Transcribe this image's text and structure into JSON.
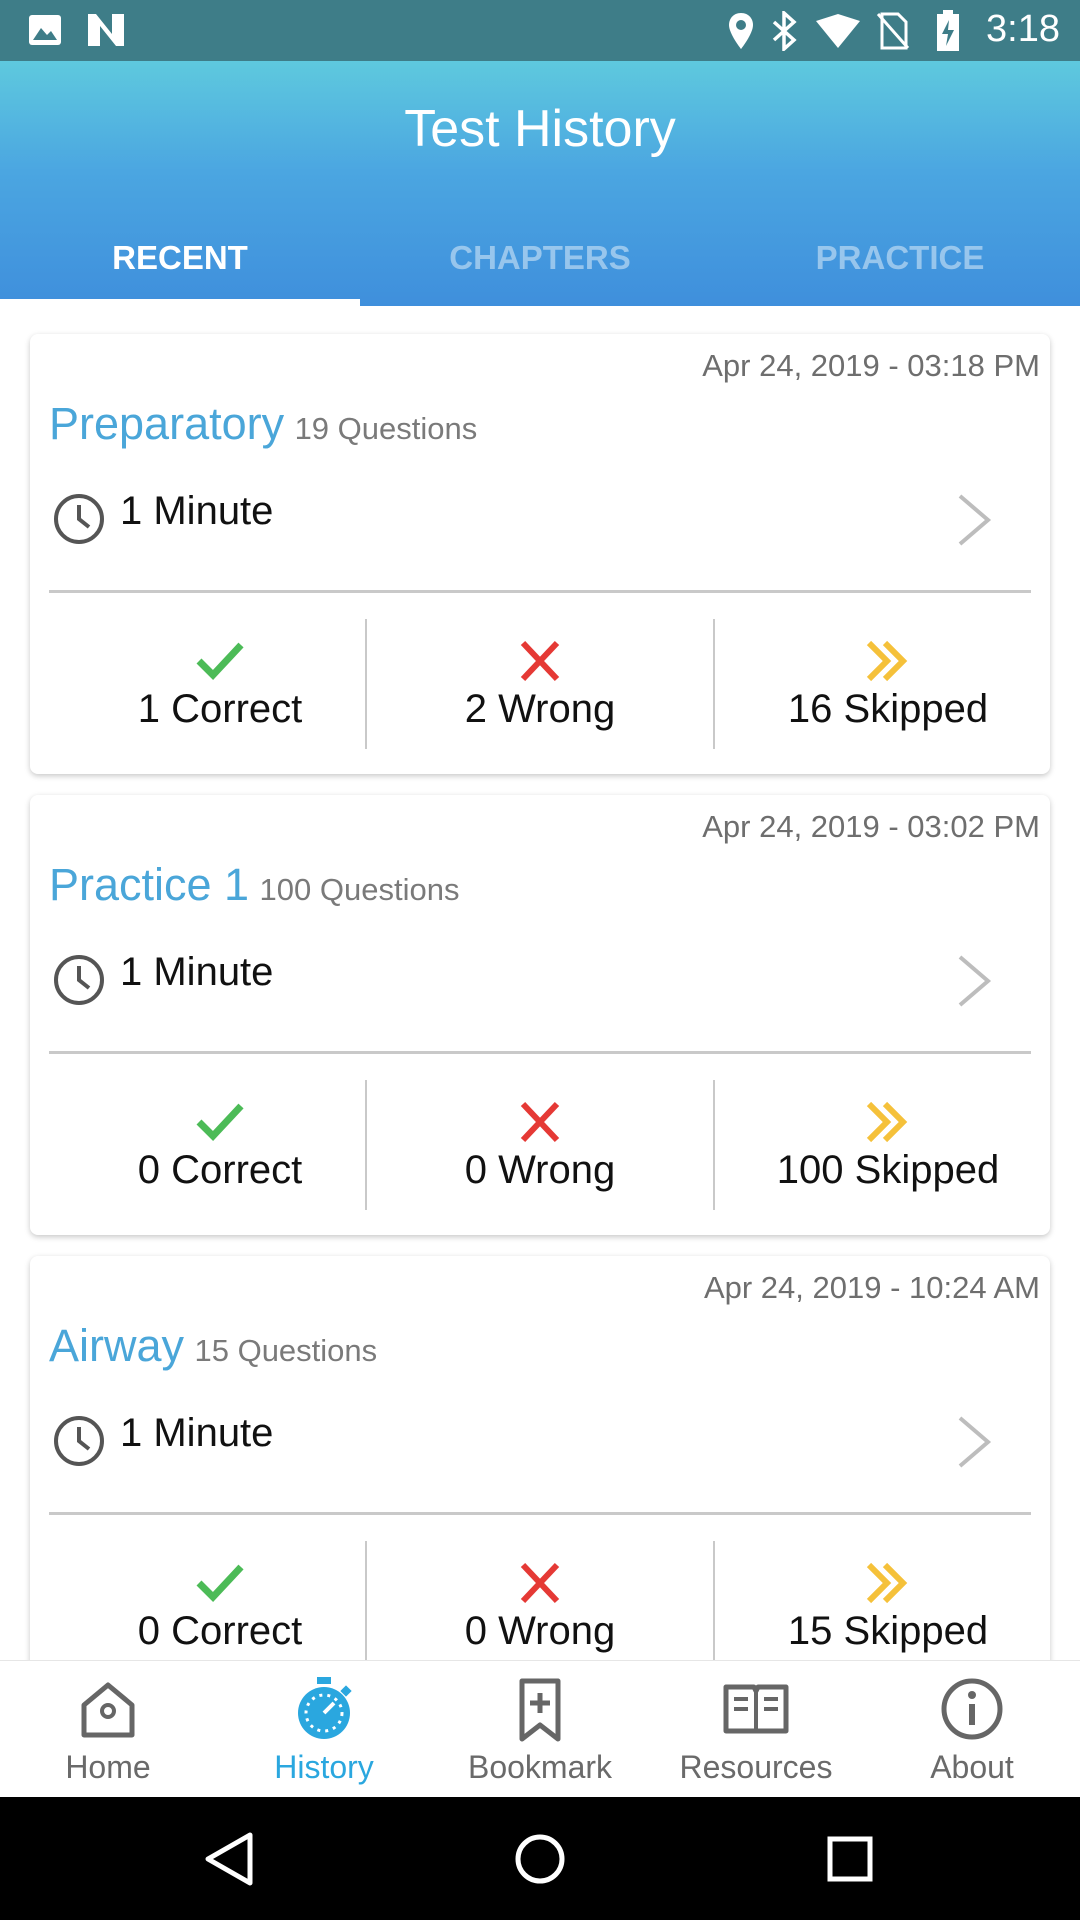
{
  "status_bar": {
    "time": "3:18",
    "left_icons": [
      "image-icon",
      "n-icon"
    ],
    "right_icons": [
      "location-icon",
      "bluetooth-icon",
      "wifi-icon",
      "no-sim-icon",
      "battery-charging-icon"
    ]
  },
  "header": {
    "title": "Test History",
    "tabs": [
      {
        "label": "RECENT",
        "active": true
      },
      {
        "label": "CHAPTERS",
        "active": false
      },
      {
        "label": "PRACTICE",
        "active": false
      }
    ]
  },
  "colors": {
    "accent": "#4aa6d9",
    "correct": "#4cbb57",
    "wrong": "#e53935",
    "skipped": "#f5c13a",
    "status_bar": "#3e7d88"
  },
  "tests": [
    {
      "date": "Apr 24, 2019 - 03:18 PM",
      "title": "Preparatory",
      "questions": "19 Questions",
      "duration": "1 Minute",
      "correct": "1 Correct",
      "wrong": "2 Wrong",
      "skipped": "16 Skipped"
    },
    {
      "date": "Apr 24, 2019 - 03:02 PM",
      "title": "Practice 1",
      "questions": "100 Questions",
      "duration": "1 Minute",
      "correct": "0 Correct",
      "wrong": "0 Wrong",
      "skipped": "100 Skipped"
    },
    {
      "date": "Apr 24, 2019 - 10:24 AM",
      "title": "Airway",
      "questions": "15 Questions",
      "duration": "1 Minute",
      "correct": "0 Correct",
      "wrong": "0 Wrong",
      "skipped": "15 Skipped"
    }
  ],
  "bottom_nav": [
    {
      "label": "Home",
      "icon": "home-icon",
      "active": false
    },
    {
      "label": "History",
      "icon": "stopwatch-icon",
      "active": true
    },
    {
      "label": "Bookmark",
      "icon": "bookmark-add-icon",
      "active": false
    },
    {
      "label": "Resources",
      "icon": "book-icon",
      "active": false
    },
    {
      "label": "About",
      "icon": "info-icon",
      "active": false
    }
  ],
  "system_nav": [
    "back-icon",
    "home-circle-icon",
    "recents-icon"
  ]
}
